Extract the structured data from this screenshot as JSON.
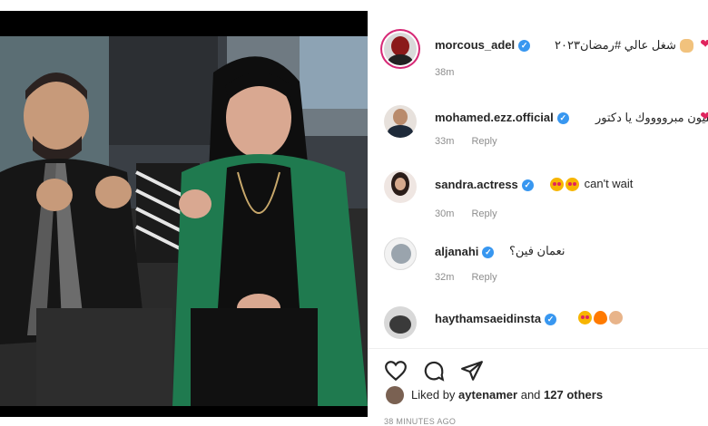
{
  "post": {
    "author": "morcous_adel",
    "caption": "شغل عالي #رمضان٢٠٢٣",
    "caption_time": "38m"
  },
  "comments": [
    {
      "username": "mohamed.ezz.official",
      "text": "مليون مبرووووك يا دكتور",
      "time": "33m",
      "reply": "Reply"
    },
    {
      "username": "sandra.actress",
      "text": "can't wait",
      "time": "30m",
      "reply": "Reply"
    },
    {
      "username": "aljanahi",
      "text": "نعمان فين؟",
      "time": "32m",
      "reply": "Reply"
    },
    {
      "username": "haythamsaeidinsta",
      "text": "",
      "time": "",
      "reply": ""
    }
  ],
  "actions": {
    "like_icon": "heart-outline-icon",
    "comment_icon": "comment-bubble-icon",
    "share_icon": "paper-plane-icon"
  },
  "likes": {
    "prefix": "Liked by",
    "user": "aytenamer",
    "middle": "and",
    "others": "127 others"
  },
  "timestamp": "38 MINUTES AGO",
  "colors": {
    "heart": "#e0245e",
    "verified": "#3897f0",
    "muted": "#8e8e8e",
    "jacket": "#1f7a4f"
  }
}
